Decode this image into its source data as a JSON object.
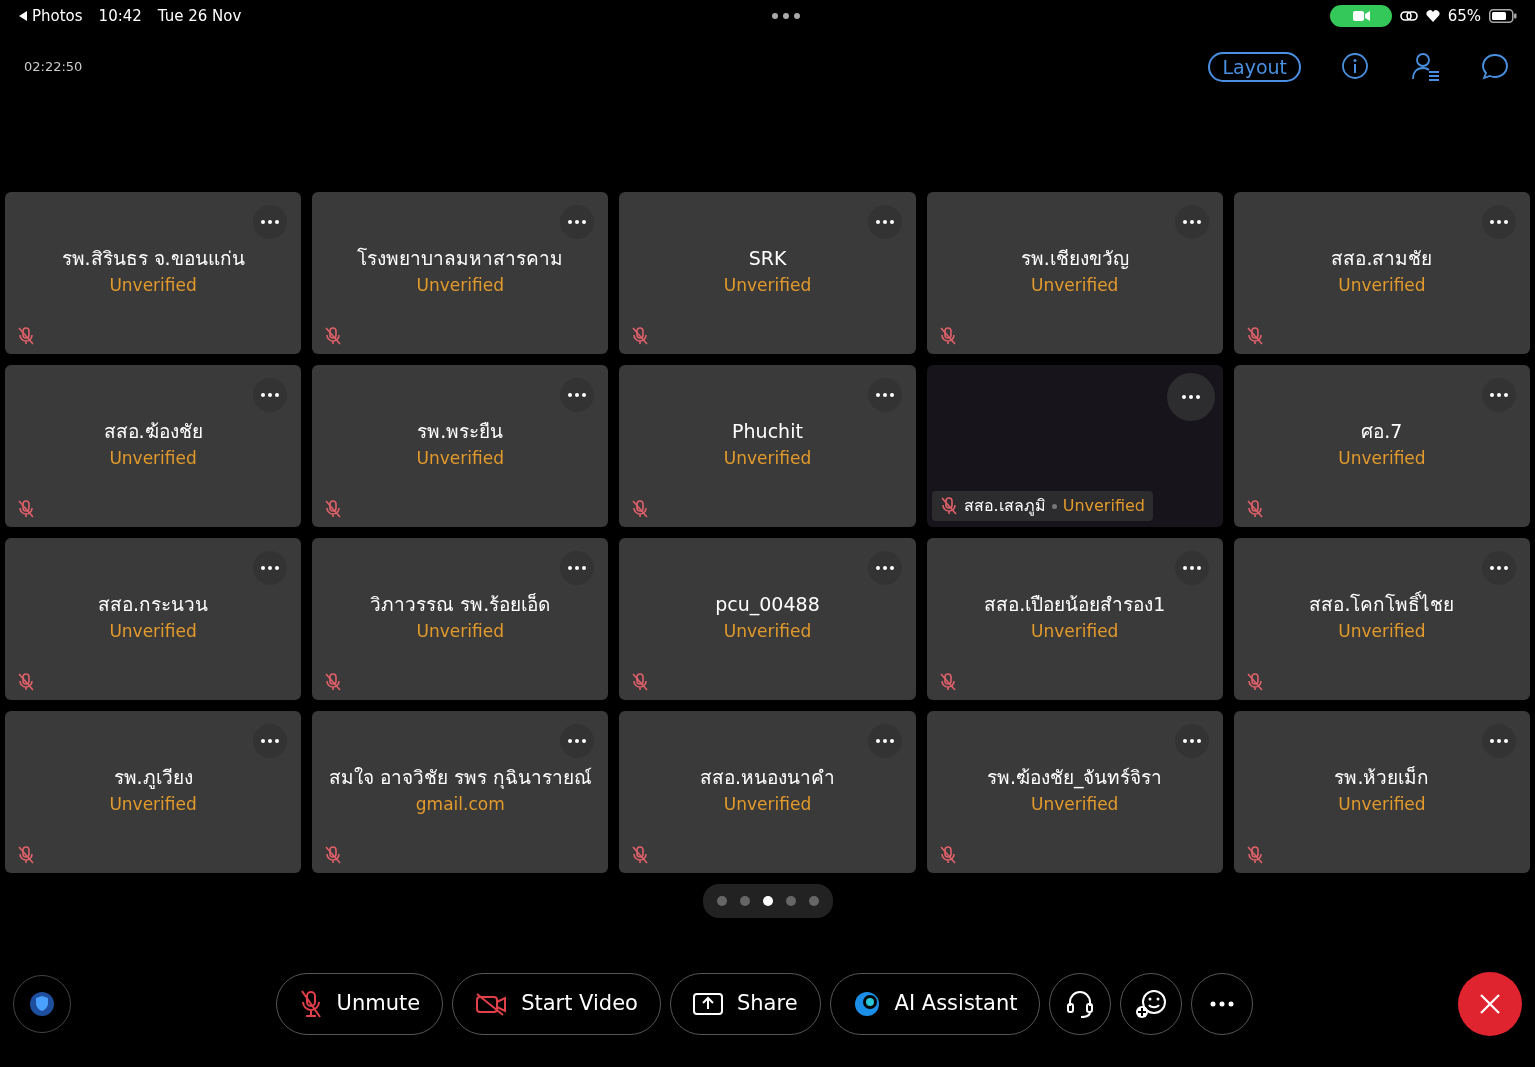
{
  "status_bar": {
    "back_label": "Photos",
    "time": "10:42",
    "date": "Tue 26 Nov",
    "battery": "65%"
  },
  "header": {
    "timer": "02:22:50",
    "layout_button": "Layout"
  },
  "tiles": [
    {
      "kind": "card",
      "name": "รพ.สิรินธร จ.ขอนแก่น",
      "status": "Unverified",
      "muted": true
    },
    {
      "kind": "card",
      "name": "โรงพยาบาลมหาสารคาม",
      "status": "Unverified",
      "muted": true
    },
    {
      "kind": "card",
      "name": "SRK",
      "status": "Unverified",
      "muted": true
    },
    {
      "kind": "card",
      "name": "รพ.เชียงขวัญ",
      "status": "Unverified",
      "muted": true
    },
    {
      "kind": "card",
      "name": "สสอ.สามชัย",
      "status": "Unverified",
      "muted": true
    },
    {
      "kind": "card",
      "name": "สสอ.ฆ้องชัย",
      "status": "Unverified",
      "muted": true
    },
    {
      "kind": "card",
      "name": "รพ.พระยืน",
      "status": "Unverified",
      "muted": true
    },
    {
      "kind": "card",
      "name": "Phuchit",
      "status": "Unverified",
      "muted": true
    },
    {
      "kind": "video",
      "name": "สสอ.เสลภูมิ",
      "status": "Unverified",
      "muted": true
    },
    {
      "kind": "card",
      "name": "ศอ.7",
      "status": "Unverified",
      "muted": true
    },
    {
      "kind": "card",
      "name": "สสอ.กระนวน",
      "status": "Unverified",
      "muted": true
    },
    {
      "kind": "card",
      "name": "วิภาวรรณ รพ.ร้อยเอ็ด",
      "status": "Unverified",
      "muted": true
    },
    {
      "kind": "card",
      "name": "pcu_00488",
      "status": "Unverified",
      "muted": true
    },
    {
      "kind": "card",
      "name": "สสอ.เปือยน้อยสำรอง1",
      "status": "Unverified",
      "muted": true
    },
    {
      "kind": "card",
      "name": "สสอ.โคกโพธิ์ไชย",
      "status": "Unverified",
      "muted": true
    },
    {
      "kind": "card",
      "name": "รพ.ภูเวียง",
      "status": "Unverified",
      "muted": true
    },
    {
      "kind": "card",
      "name": "สมใจ อาจวิชัย รพร กุฉินารายณ์",
      "status": "gmail.com",
      "muted": true
    },
    {
      "kind": "card",
      "name": "สสอ.หนองนาคำ",
      "status": "Unverified",
      "muted": true
    },
    {
      "kind": "card",
      "name": "รพ.ฆ้องชัย_จันทร์จิรา",
      "status": "Unverified",
      "muted": true
    },
    {
      "kind": "card",
      "name": "รพ.ห้วยเม็ก",
      "status": "Unverified",
      "muted": true
    }
  ],
  "pages": [
    {
      "selected": false
    },
    {
      "selected": false
    },
    {
      "selected": true
    },
    {
      "selected": false
    },
    {
      "selected": false
    }
  ],
  "toolbar": [
    {
      "kind": "unmute",
      "label": "Unmute"
    },
    {
      "kind": "video",
      "label": "Start Video"
    },
    {
      "kind": "share",
      "label": "Share"
    },
    {
      "kind": "ai",
      "label": "AI Assistant"
    },
    {
      "kind": "support"
    },
    {
      "kind": "reaction"
    },
    {
      "kind": "more"
    }
  ]
}
